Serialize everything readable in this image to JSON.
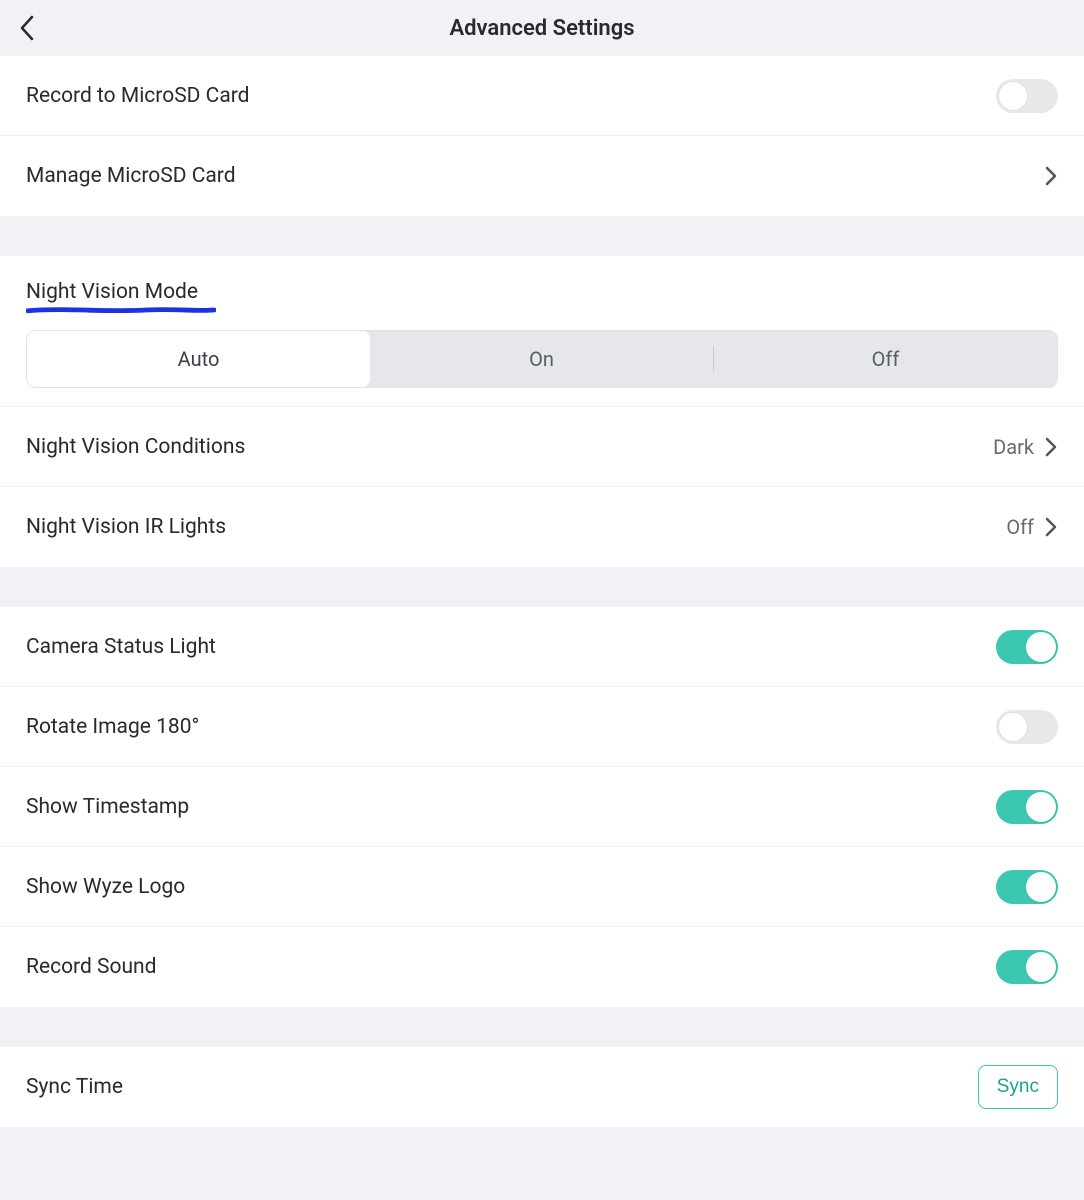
{
  "header": {
    "title": "Advanced Settings"
  },
  "storage": {
    "record_to_sd": {
      "label": "Record to MicroSD Card",
      "on": false
    },
    "manage_sd": {
      "label": "Manage MicroSD Card"
    }
  },
  "night_vision": {
    "section_label": "Night Vision Mode",
    "segments": [
      "Auto",
      "On",
      "Off"
    ],
    "selected": "Auto",
    "conditions": {
      "label": "Night Vision Conditions",
      "value": "Dark"
    },
    "ir_lights": {
      "label": "Night Vision IR Lights",
      "value": "Off"
    }
  },
  "camera": {
    "status_light": {
      "label": "Camera Status Light",
      "on": true
    },
    "rotate_180": {
      "label": "Rotate Image 180°",
      "on": false
    },
    "show_timestamp": {
      "label": "Show Timestamp",
      "on": true
    },
    "show_logo": {
      "label": "Show Wyze Logo",
      "on": true
    },
    "record_sound": {
      "label": "Record Sound",
      "on": true
    }
  },
  "sync": {
    "label": "Sync Time",
    "button": "Sync"
  },
  "colors": {
    "accent": "#3cc7b0",
    "annotation": "#1c33e0"
  }
}
